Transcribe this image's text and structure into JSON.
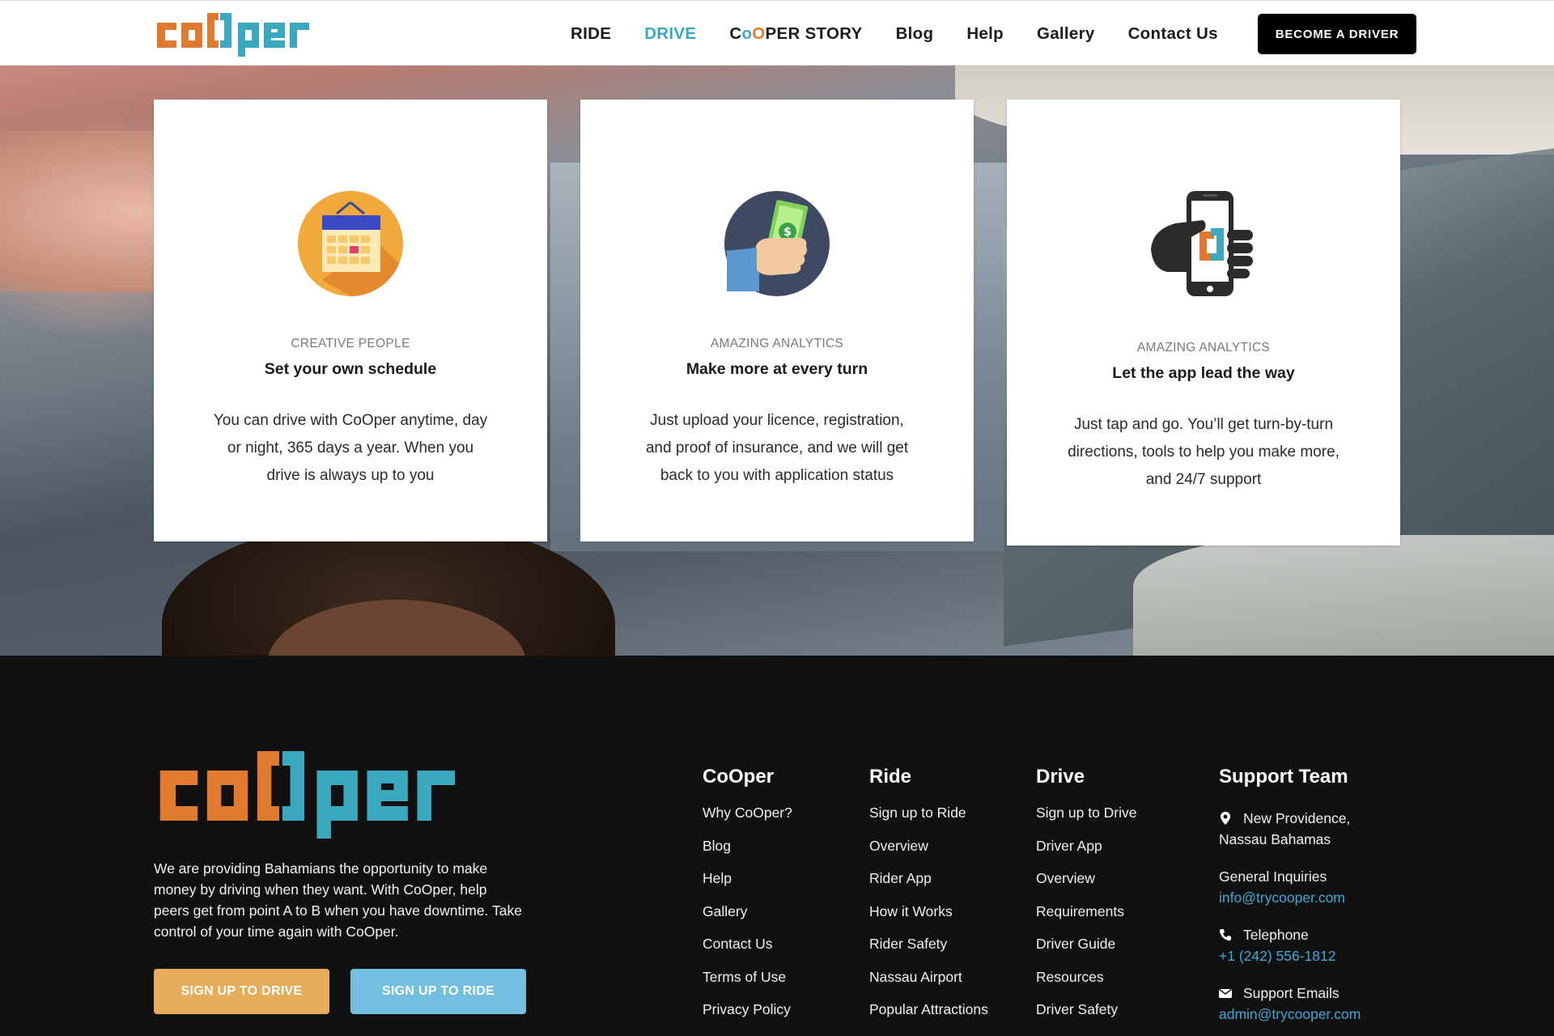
{
  "header": {
    "logo_text": "coOper",
    "nav": [
      {
        "label": "RIDE",
        "active": false
      },
      {
        "label": "DRIVE",
        "active": true
      },
      {
        "label": "CoOPER STORY",
        "active": false
      },
      {
        "label": "Blog",
        "active": false
      },
      {
        "label": "Help",
        "active": false
      },
      {
        "label": "Gallery",
        "active": false
      },
      {
        "label": "Contact Us",
        "active": false
      }
    ],
    "story_parts": [
      "C",
      "o",
      "O",
      "PER STORY"
    ],
    "cta": "BECOME A DRIVER"
  },
  "cards": [
    {
      "kicker": "CREATIVE PEOPLE",
      "title": "Set your own schedule",
      "body": "You can drive with CoOper anytime, day or night, 365 days a year. When you drive is always up to you",
      "icon": "calendar-icon"
    },
    {
      "kicker": "AMAZING ANALYTICS",
      "title": "Make more at every turn",
      "body": "Just upload your licence, registration, and proof of insurance, and we will get back to you with application status",
      "icon": "money-hand-icon"
    },
    {
      "kicker": "AMAZING ANALYTICS",
      "title": "Let the app lead the way",
      "body": "Just tap and go. You’ll get turn-by-turn directions, tools to help you make more, and 24/7 support",
      "icon": "phone-hand-icon"
    }
  ],
  "footer": {
    "about": "We are providing Bahamians the opportunity to make money by driving when they want. With CoOper, help peers get from point A to B when you have downtime. Take control of your time again with CoOper.",
    "btn_drive": "SIGN UP TO DRIVE",
    "btn_ride": "SIGN UP TO RIDE",
    "columns": [
      {
        "heading": "CoOper",
        "items": [
          "Why CoOper?",
          "Blog",
          "Help",
          "Gallery",
          "Contact Us",
          "Terms of Use",
          "Privacy Policy"
        ]
      },
      {
        "heading": "Ride",
        "items": [
          "Sign up to Ride",
          "Overview",
          "Rider App",
          "How it Works",
          "Rider Safety",
          "Nassau Airport",
          "Popular Attractions"
        ]
      },
      {
        "heading": "Drive",
        "items": [
          "Sign up to Drive",
          "Driver App",
          "Overview",
          "Requirements",
          "Driver Guide",
          "Resources",
          "Driver Safety"
        ]
      }
    ],
    "support": {
      "heading": "Support Team",
      "address_line1": "New Providence,",
      "address_line2": "Nassau Bahamas",
      "inquiries_label": "General Inquiries",
      "inquiries_email": "info@trycooper.com",
      "phone_label": "Telephone",
      "phone": "+1 (242) 556-1812",
      "support_label": "Support Emails",
      "support_email": "admin@trycooper.com"
    }
  },
  "colors": {
    "orange": "#e07a2e",
    "teal": "#3aa9c0",
    "drive_btn": "#e8ad5a",
    "ride_btn": "#73bfe0"
  }
}
